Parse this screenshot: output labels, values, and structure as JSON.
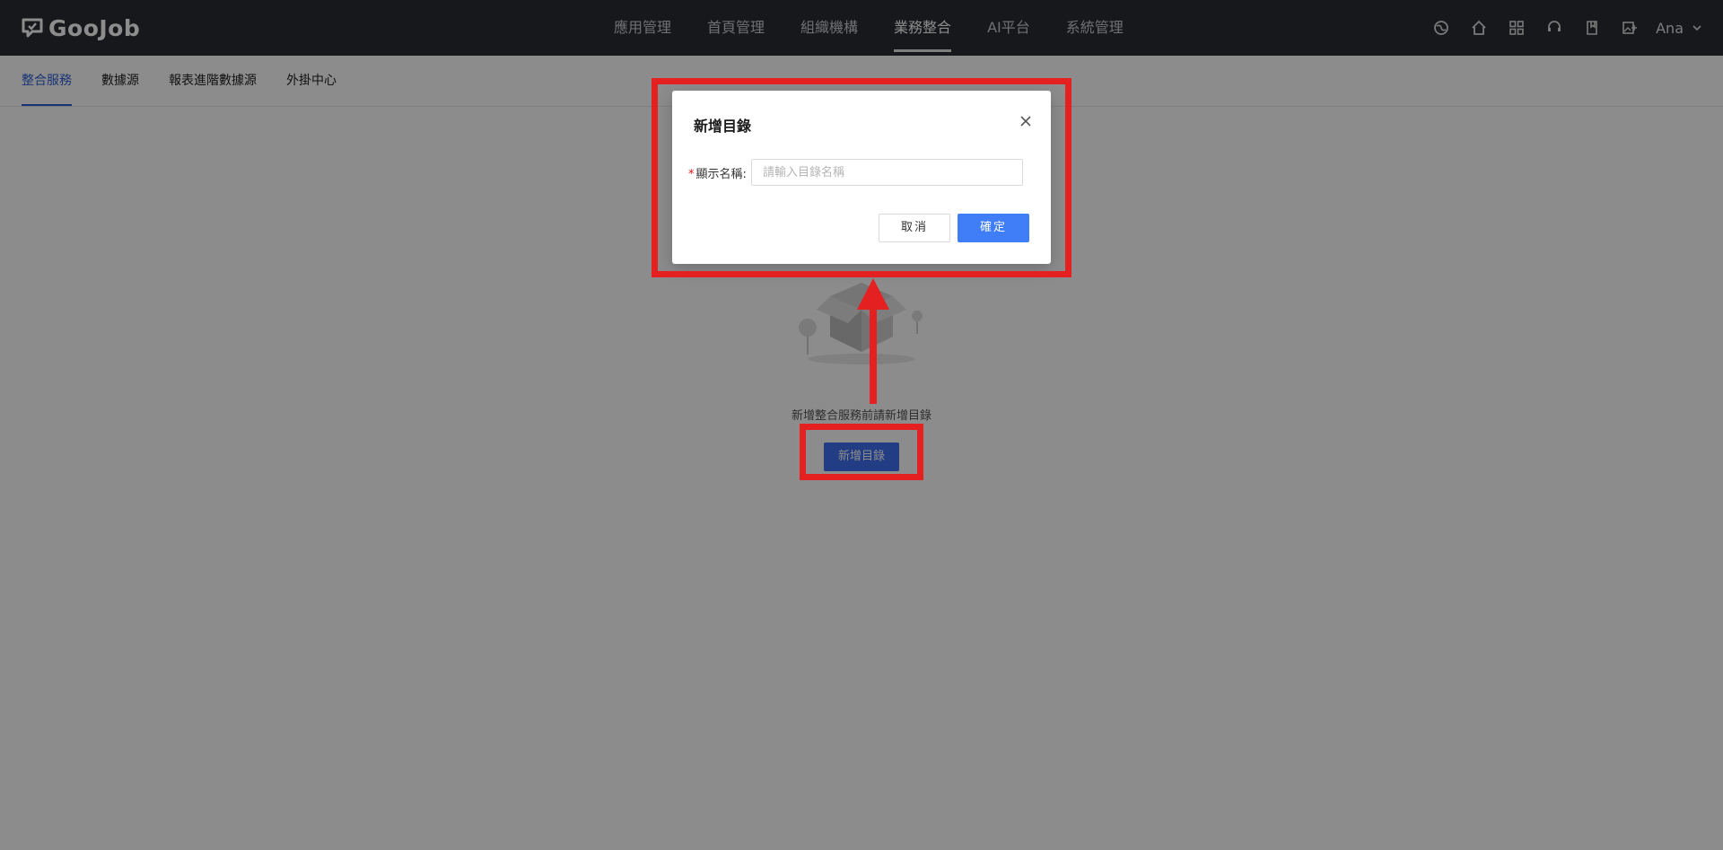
{
  "app": {
    "logo_text": "GooJob"
  },
  "topnav": {
    "items": [
      {
        "label": "應用管理",
        "active": false
      },
      {
        "label": "首頁管理",
        "active": false
      },
      {
        "label": "組織機構",
        "active": false
      },
      {
        "label": "業務整合",
        "active": true
      },
      {
        "label": "AI平台",
        "active": false
      },
      {
        "label": "系統管理",
        "active": false
      }
    ]
  },
  "toolbar": {
    "icons": [
      "theme-icon",
      "home-icon",
      "apps-grid-icon",
      "support-icon",
      "bookmark-icon",
      "upload-image-icon"
    ],
    "user_name": "Ana"
  },
  "subnav": {
    "items": [
      {
        "label": "整合服務",
        "active": true
      },
      {
        "label": "數據源",
        "active": false
      },
      {
        "label": "報表進階數據源",
        "active": false
      },
      {
        "label": "外掛中心",
        "active": false
      }
    ]
  },
  "empty_state": {
    "message": "新增整合服務前請新增目錄",
    "button_label": "新增目錄"
  },
  "modal": {
    "title": "新增目錄",
    "field_label": "顯示名稱:",
    "field_required_mark": "*",
    "field_value": "",
    "field_placeholder": "請輸入目錄名稱",
    "cancel_label": "取消",
    "ok_label": "確定"
  },
  "colors": {
    "topbar_bg": "#2a2d33",
    "accent": "#3f7ef7",
    "annotation": "#e52020"
  }
}
